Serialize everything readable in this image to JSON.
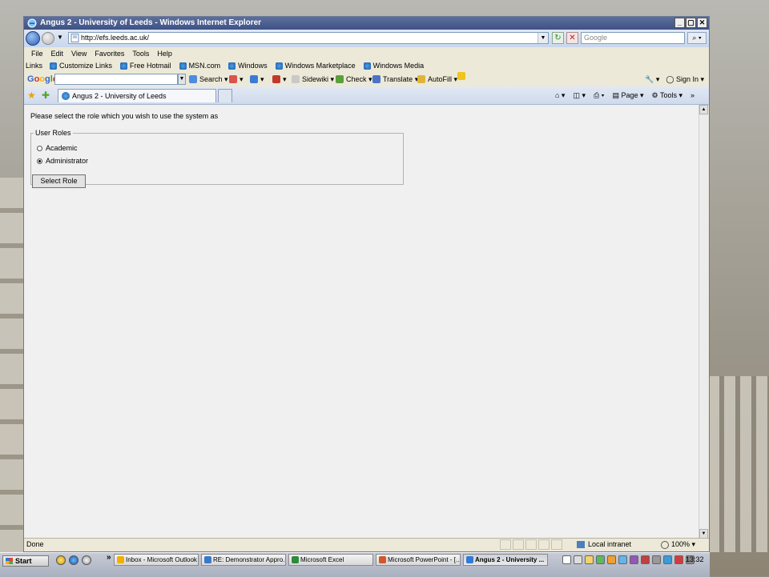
{
  "window": {
    "title": "Angus 2 - University of Leeds - Windows Internet Explorer",
    "controls": [
      "_",
      "▢",
      "✕"
    ]
  },
  "address": {
    "url": "http://efs.leeds.ac.uk/",
    "search_placeholder": "Google"
  },
  "menu": [
    "File",
    "Edit",
    "View",
    "Favorites",
    "Tools",
    "Help"
  ],
  "links_bar": {
    "label": "Links",
    "items": [
      "Customize Links",
      "Free Hotmail",
      "MSN.com",
      "Windows",
      "Windows Marketplace",
      "Windows Media"
    ]
  },
  "google_toolbar": {
    "logo": [
      "G",
      "o",
      "o",
      "g",
      "l",
      "e"
    ],
    "tools": [
      "Search",
      "Sidewiki",
      "Check",
      "Translate",
      "AutoFill"
    ],
    "sign_in": "Sign In"
  },
  "tab": {
    "title": "Angus 2 - University of Leeds"
  },
  "command_bar": [
    "Page",
    "Tools"
  ],
  "page": {
    "prompt": "Please select the role which you wish to use the system as",
    "legend": "User Roles",
    "roles": [
      {
        "label": "Academic",
        "selected": false
      },
      {
        "label": "Administrator",
        "selected": true
      }
    ],
    "submit_label": "Select Role"
  },
  "status": {
    "text": "Done",
    "zone": "Local intranet",
    "zoom": "100%"
  },
  "taskbar": {
    "start": "Start",
    "overflow": "»",
    "tasks": [
      {
        "label": "Inbox - Microsoft Outlook",
        "color": "#f0b000"
      },
      {
        "label": "RE: Demonstrator Appro...",
        "color": "#3a78c9"
      },
      {
        "label": "Microsoft Excel",
        "color": "#2f8a3a"
      },
      {
        "label": "Microsoft PowerPoint - [...",
        "color": "#d2562e"
      },
      {
        "label": "Angus 2 - University ...",
        "color": "#2f7bd8"
      }
    ],
    "clock": "13:32"
  }
}
